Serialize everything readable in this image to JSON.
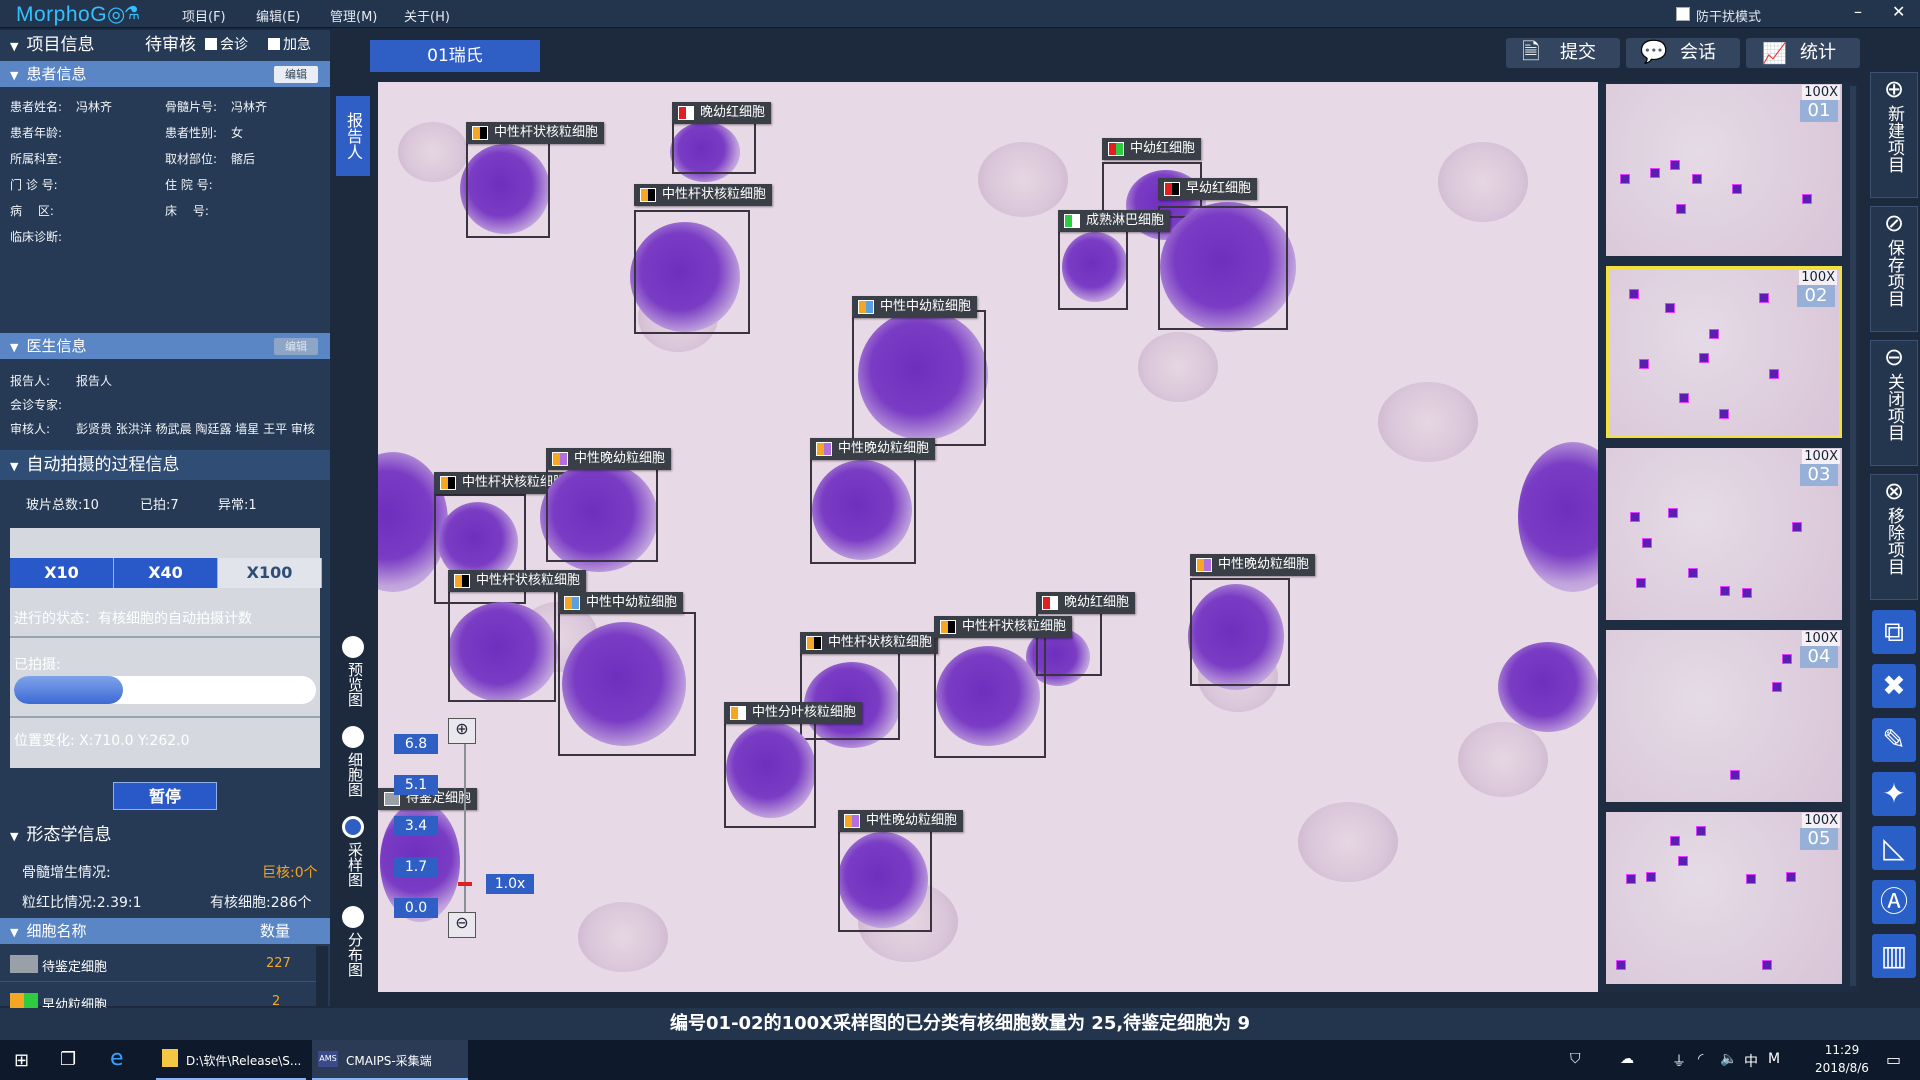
{
  "app": {
    "logo": "MorphoG◎",
    "menu": [
      "项目(F)",
      "编辑(E)",
      "管理(M)",
      "关于(H)"
    ],
    "mode_label": "防干扰模式",
    "win": [
      "–",
      "□",
      "✕"
    ]
  },
  "project": {
    "title": "项目信息",
    "status": "待审核",
    "opt1": "会诊",
    "opt2": "加急"
  },
  "patient": {
    "title": "患者信息",
    "edit": "编辑",
    "name_label": "患者姓名:",
    "name": "冯林齐",
    "marrow_label": "骨髓片号:",
    "marrow": "冯林齐",
    "age_label": "患者年龄:",
    "age": "",
    "sex_label": "患者性别:",
    "sex": "女",
    "dept_label": "所属科室:",
    "dept": "",
    "site_label": "取材部位:",
    "site": "髂后",
    "clinic_label": "门 诊 号:",
    "inpatient_label": "住 院 号:",
    "ward_label": "病　 区:",
    "bed_label": "床　 号:",
    "diag_label": "临床诊断:"
  },
  "doctor": {
    "title": "医生信息",
    "edit": "编辑",
    "reporter_label": "报告人:",
    "reporter": "报告人",
    "consult_label": "会诊专家:",
    "reviewer_label": "审核人:",
    "reviewers": "彭贤贵 张洪洋 杨武晨 陶廷露 墙星 王平 审核"
  },
  "auto": {
    "title": "自动拍摄的过程信息",
    "total": "玻片总数:10",
    "done": "已拍:7",
    "abnormal": "异常:1",
    "zooms": [
      "X10",
      "X40",
      "X100"
    ],
    "state": "进行的状态：有核细胞的自动拍摄计数",
    "shot_label": "已拍摄:",
    "progress": 0.36,
    "pos": "位置变化:  X:710.0 Y:262.0",
    "pause": "暂停"
  },
  "morph": {
    "title": "形态学信息",
    "marrow": "骨髓增生情况:",
    "mega": "巨核:0个",
    "ratio": "粒红比情况:2.39:1",
    "nucleated": "有核细胞:286个",
    "col_name": "细胞名称",
    "col_count": "数量",
    "rows": [
      {
        "name": "待鉴定细胞",
        "count": "227",
        "c1": "#9aa0a8",
        "c2": "#9aa0a8"
      },
      {
        "name": "早幼粒细胞",
        "count": "2",
        "c1": "#f5a623",
        "c2": "#2ecc40"
      }
    ]
  },
  "viewer": {
    "tab": "01瑞氏",
    "submit": "提交",
    "chat": "会话",
    "stats": "统计",
    "report_side": "报告人",
    "side_items": [
      "预览图",
      "细胞图",
      "采样图",
      "分布图"
    ],
    "scale": [
      "6.8",
      "5.1",
      "3.4",
      "1.7",
      "0.0"
    ],
    "zoom": "1.0x",
    "labels": [
      {
        "t": "中性杆状核粒细胞",
        "c1": "#f5a623",
        "c2": "#000000"
      },
      {
        "t": "晚幼红细胞",
        "c1": "#e02020",
        "c2": "#ffffff"
      },
      {
        "t": "中性杆状核粒细胞",
        "c1": "#f5a623",
        "c2": "#000000"
      },
      {
        "t": "中幼红细胞",
        "c1": "#e02020",
        "c2": "#2ecc40"
      },
      {
        "t": "早幼红细胞",
        "c1": "#e02020",
        "c2": "#000000"
      },
      {
        "t": "成熟淋巴细胞",
        "c1": "#2ecc40",
        "c2": "#ffffff"
      },
      {
        "t": "中性中幼粒细胞",
        "c1": "#f5a623",
        "c2": "#5aa0e0"
      },
      {
        "t": "中性晚幼粒细胞",
        "c1": "#f5a623",
        "c2": "#b070e0"
      },
      {
        "t": "中性杆状核粒细胞",
        "c1": "#f5a623",
        "c2": "#000000"
      },
      {
        "t": "中性晚幼粒细胞",
        "c1": "#f5a623",
        "c2": "#b070e0"
      },
      {
        "t": "中性杆状核粒细胞",
        "c1": "#f5a623",
        "c2": "#000000"
      },
      {
        "t": "中性中幼粒细胞",
        "c1": "#f5a623",
        "c2": "#5aa0e0"
      },
      {
        "t": "晚幼红细胞",
        "c1": "#e02020",
        "c2": "#ffffff"
      },
      {
        "t": "中性晚幼粒细胞",
        "c1": "#f5a623",
        "c2": "#b070e0"
      },
      {
        "t": "中性杆状核粒细胞",
        "c1": "#f5a623",
        "c2": "#000000"
      },
      {
        "t": "中性杆状核粒细胞",
        "c1": "#f5a623",
        "c2": "#000000"
      },
      {
        "t": "中性分叶核粒细胞",
        "c1": "#f5a623",
        "c2": "#ffffff"
      },
      {
        "t": "中性晚幼粒细胞",
        "c1": "#f5a623",
        "c2": "#b070e0"
      },
      {
        "t": "待鉴定细胞",
        "c1": "#9aa0a8",
        "c2": "#9aa0a8"
      }
    ]
  },
  "thumbs": [
    {
      "mag": "100X",
      "num": "01"
    },
    {
      "mag": "100X",
      "num": "02"
    },
    {
      "mag": "100X",
      "num": "03"
    },
    {
      "mag": "100X",
      "num": "04"
    },
    {
      "mag": "100X",
      "num": "05"
    }
  ],
  "rightbar": {
    "new": "新建项目",
    "save": "保存项目",
    "close": "关闭项目",
    "remove": "移除项目"
  },
  "status": "编号01-02的100X采样图的已分类有核细胞数量为 25,待鉴定细胞为 9",
  "taskbar": {
    "explorer": "D:\\软件\\Release\\S...",
    "app": "CMAIPS-采集端",
    "time": "11:29",
    "date": "2018/8/6",
    "ime": "中",
    "m": "M"
  }
}
